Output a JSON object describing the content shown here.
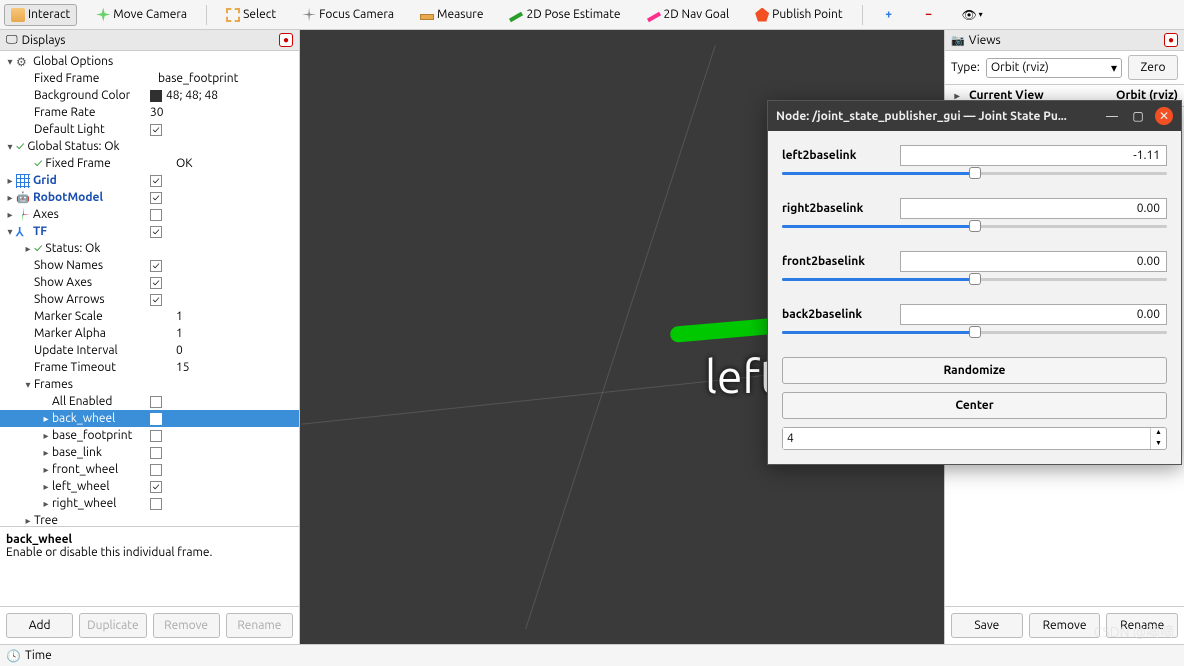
{
  "toolbar": {
    "interact": "Interact",
    "move_camera": "Move Camera",
    "select": "Select",
    "focus_camera": "Focus Camera",
    "measure": "Measure",
    "pose_2d": "2D Pose Estimate",
    "nav_2d": "2D Nav Goal",
    "publish": "Publish Point"
  },
  "displays": {
    "title": "Displays",
    "global_options": "Global Options",
    "fixed_frame": {
      "label": "Fixed Frame",
      "value": "base_footprint"
    },
    "bg_color": {
      "label": "Background Color",
      "value": "48; 48; 48"
    },
    "frame_rate": {
      "label": "Frame Rate",
      "value": "30"
    },
    "default_light": "Default Light",
    "global_status": "Global Status: Ok",
    "fixed_frame_status": {
      "label": "Fixed Frame",
      "value": "OK"
    },
    "grid": "Grid",
    "robot_model": "RobotModel",
    "axes": "Axes",
    "tf": "TF",
    "status_ok": "Status: Ok",
    "show_names": "Show Names",
    "show_axes": "Show Axes",
    "show_arrows": "Show Arrows",
    "marker_scale": {
      "label": "Marker Scale",
      "value": "1"
    },
    "marker_alpha": {
      "label": "Marker Alpha",
      "value": "1"
    },
    "update_interval": {
      "label": "Update Interval",
      "value": "0"
    },
    "frame_timeout": {
      "label": "Frame Timeout",
      "value": "15"
    },
    "frames": "Frames",
    "all_enabled": "All Enabled",
    "frame_items": [
      "back_wheel",
      "base_footprint",
      "base_link",
      "front_wheel",
      "left_wheel",
      "right_wheel"
    ],
    "tree": "Tree",
    "desc_title": "back_wheel",
    "desc_body": "Enable or disable this individual frame.",
    "add": "Add",
    "duplicate": "Duplicate",
    "remove": "Remove",
    "rename": "Rename"
  },
  "viewport": {
    "label": "left_wheel"
  },
  "views": {
    "title": "Views",
    "type_label": "Type:",
    "type_value": "Orbit (rviz)",
    "zero": "Zero",
    "current_view": "Current View",
    "current_value": "Orbit (rviz)",
    "save": "Save",
    "remove": "Remove",
    "rename": "Rename"
  },
  "jsp": {
    "title": "Node: /joint_state_publisher_gui — Joint State Pu...",
    "joints": [
      {
        "name": "left2baselink",
        "value": "-1.11",
        "fill": 50,
        "thumb": 50
      },
      {
        "name": "right2baselink",
        "value": "0.00",
        "fill": 50,
        "thumb": 50
      },
      {
        "name": "front2baselink",
        "value": "0.00",
        "fill": 50,
        "thumb": 50
      },
      {
        "name": "back2baselink",
        "value": "0.00",
        "fill": 50,
        "thumb": 50
      }
    ],
    "randomize": "Randomize",
    "center": "Center",
    "spin": "4"
  },
  "time": {
    "label": "Time"
  },
  "watermark": "CSDN @嘀嘀"
}
